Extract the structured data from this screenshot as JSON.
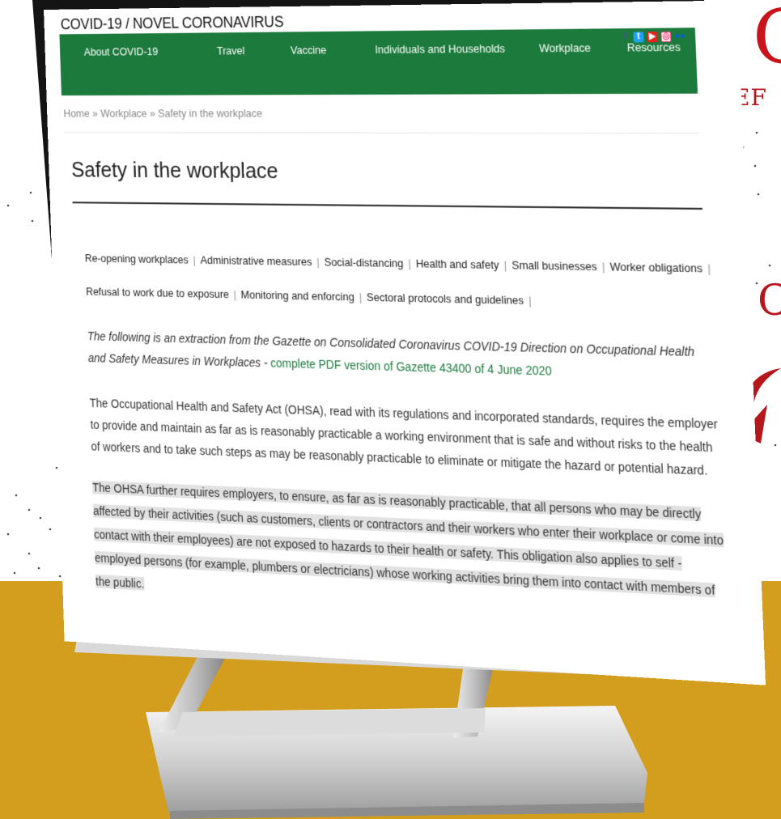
{
  "site": {
    "title": "COVID-19 / NOVEL CORONAVIRUS"
  },
  "nav": {
    "items": [
      "About COVID-19",
      "Travel",
      "Vaccine",
      "Individuals and Households",
      "Workplace",
      "Resources"
    ],
    "social_icons": [
      "facebook-icon",
      "twitter-icon",
      "youtube-icon",
      "instagram-icon",
      "flickr-icon"
    ]
  },
  "breadcrumb": {
    "home": "Home",
    "section": "Workplace",
    "current": "Safety in the workplace",
    "separator": "»"
  },
  "page": {
    "title": "Safety in the workplace"
  },
  "subnav": {
    "row1": [
      "Re-opening workplaces",
      "Administrative measures",
      "Social-distancing",
      "Health and safety",
      "Small businesses",
      "Worker obligations"
    ],
    "row2": [
      "Refusal to work due to exposure",
      "Monitoring and enforcing",
      "Sectoral protocols and guidelines"
    ]
  },
  "content": {
    "intro_text": "The following is an extraction from the Gazette on Consolidated Coronavirus COVID-19 Direction on Occupational Health and Safety Measures in Workplaces - ",
    "intro_link": "complete PDF version of Gazette 43400 of 4 June 2020",
    "para1": "The Occupational Health and Safety Act (OHSA), read with its regulations and incorporated standards, requires the employer to provide and maintain as far as is reasonably practicable a working environment that is safe and without risks to the health of workers and to take such steps as may be reasonably practicable to eliminate or mitigate the hazard or potential hazard.",
    "para2": "The OHSA further requires employers, to ensure, as far as is reasonably practicable, that all persons who may be directly affected by their activities (such as customers, clients or contractors and their workers who enter their workplace or come into contact with their employees) are not exposed to hazards to their health or safety. This obligation also applies to self - employed persons (for example, plumbers or electricians) whose working activities bring them into contact with members of the public."
  },
  "decor": {
    "ref_text": "REF"
  },
  "colors": {
    "nav_green": "#1d7a3d",
    "accent_red": "#c8141a",
    "floor_gold": "#d39d1d",
    "highlight": "#e2e2e2"
  }
}
